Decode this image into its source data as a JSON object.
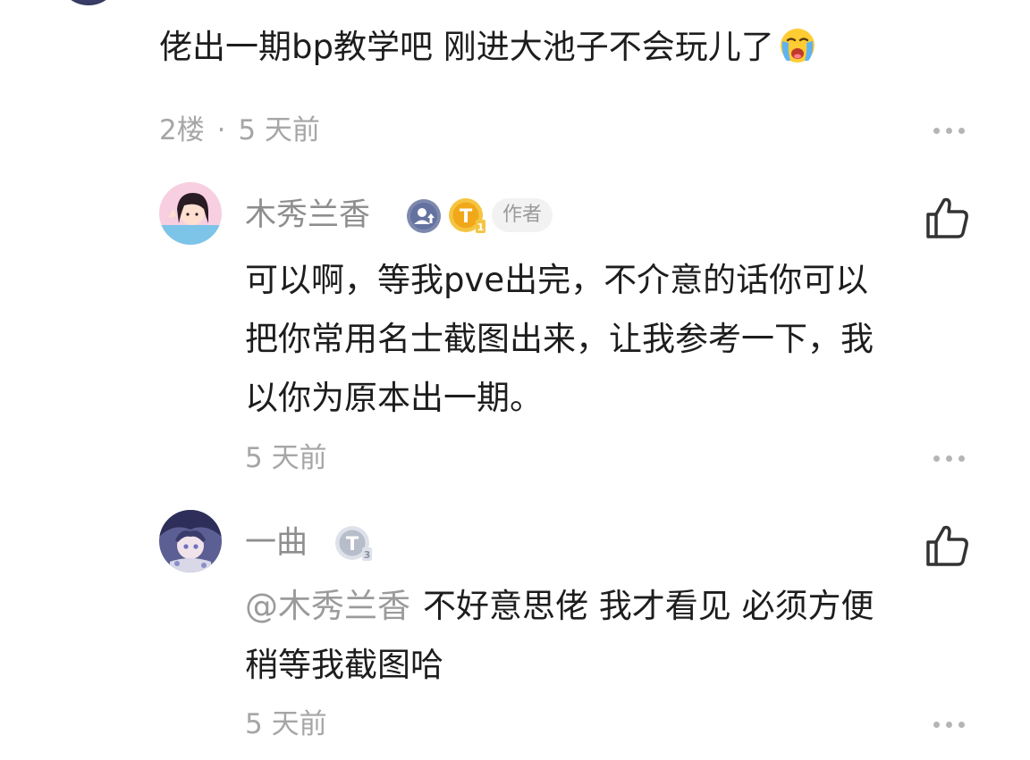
{
  "floor_comment": {
    "text": "佬出一期bp教学吧 刚进大池子不会玩儿了",
    "emoji": "crying-face-icon",
    "floor": "2楼",
    "dot": "·",
    "time": "5 天前"
  },
  "replies": [
    {
      "username": "木秀兰香",
      "badges": [
        "upload-level-icon",
        "t1-level-icon"
      ],
      "author_tag": "作者",
      "lines": [
        "可以啊，等我pve出完，不介意的话你可以",
        "把你常用名士截图出来，让我参考一下，我",
        "以你为原本出一期。"
      ],
      "time": "5 天前"
    },
    {
      "username": "一曲",
      "badges": [
        "t3-level-icon"
      ],
      "mention": "@木秀兰香",
      "lines": [
        "不好意思佬 我才看见 必须方便",
        "稍等我截图哈"
      ],
      "time": "5 天前"
    }
  ],
  "colors": {
    "text": "#1d1d1d",
    "meta": "#a6a6a6",
    "username": "#8e8e8e",
    "badge_blue": "#6f7ea8",
    "badge_gold": "#f2b01e",
    "badge_silver": "#c9ced8"
  }
}
